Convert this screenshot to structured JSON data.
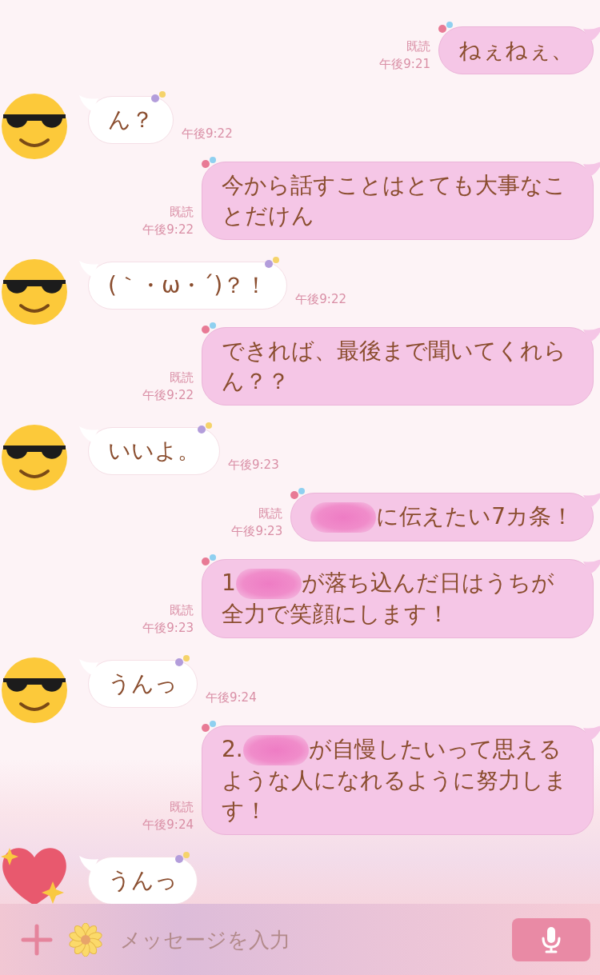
{
  "messages": [
    {
      "kind": "sent",
      "read": "既読",
      "time": "午後9:21",
      "segments": [
        {
          "kind": "text",
          "text": "ねぇねぇ、"
        }
      ]
    },
    {
      "kind": "received",
      "time": "午後9:22",
      "segments": [
        {
          "kind": "text",
          "text": "ん？"
        }
      ]
    },
    {
      "kind": "sent",
      "read": "既読",
      "time": "午後9:22",
      "segments": [
        {
          "kind": "text",
          "text": "今から話すことはとても大事なことだけん"
        }
      ]
    },
    {
      "kind": "received",
      "time": "午後9:22",
      "segments": [
        {
          "kind": "text",
          "text": "(｀・ω・´)？！"
        }
      ]
    },
    {
      "kind": "sent",
      "read": "既読",
      "time": "午後9:22",
      "segments": [
        {
          "kind": "text",
          "text": "できれば、最後まで聞いてくれらん？？"
        }
      ]
    },
    {
      "kind": "received",
      "time": "午後9:23",
      "segments": [
        {
          "kind": "text",
          "text": "いいよ。"
        }
      ]
    },
    {
      "kind": "sent",
      "read": "既読",
      "time": "午後9:23",
      "segments": [
        {
          "kind": "redacted"
        },
        {
          "kind": "text",
          "text": "に伝えたい7カ条！"
        }
      ]
    },
    {
      "kind": "sent",
      "read": "既読",
      "time": "午後9:23",
      "segments": [
        {
          "kind": "text",
          "text": "1"
        },
        {
          "kind": "redacted"
        },
        {
          "kind": "text",
          "text": "が落ち込んだ日はうちが全力で笑顔にします！"
        }
      ]
    },
    {
      "kind": "received",
      "time": "午後9:24",
      "segments": [
        {
          "kind": "text",
          "text": "うんっ"
        }
      ]
    },
    {
      "kind": "sent",
      "read": "既読",
      "time": "午後9:24",
      "segments": [
        {
          "kind": "text",
          "text": "2."
        },
        {
          "kind": "redacted"
        },
        {
          "kind": "text",
          "text": "が自慢したいって思えるような人になれるように努力します！"
        }
      ]
    },
    {
      "kind": "heart",
      "segments": [
        {
          "kind": "text",
          "text": "うんっ"
        }
      ]
    }
  ],
  "input": {
    "placeholder": "メッセージを入力"
  }
}
